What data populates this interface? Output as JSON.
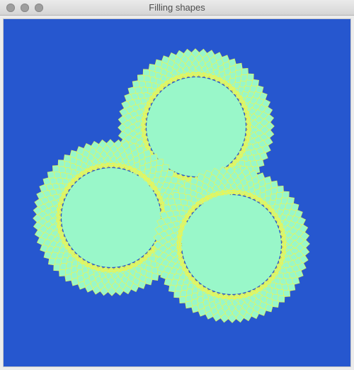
{
  "window": {
    "title": "Filling shapes"
  },
  "scene": {
    "background_color": "#2657cf",
    "fill_color": "#99f7c9",
    "stroke_color": "#f5f545",
    "shapes": [
      {
        "name": "top-circle"
      },
      {
        "name": "left-circle"
      },
      {
        "name": "right-circle"
      }
    ]
  }
}
